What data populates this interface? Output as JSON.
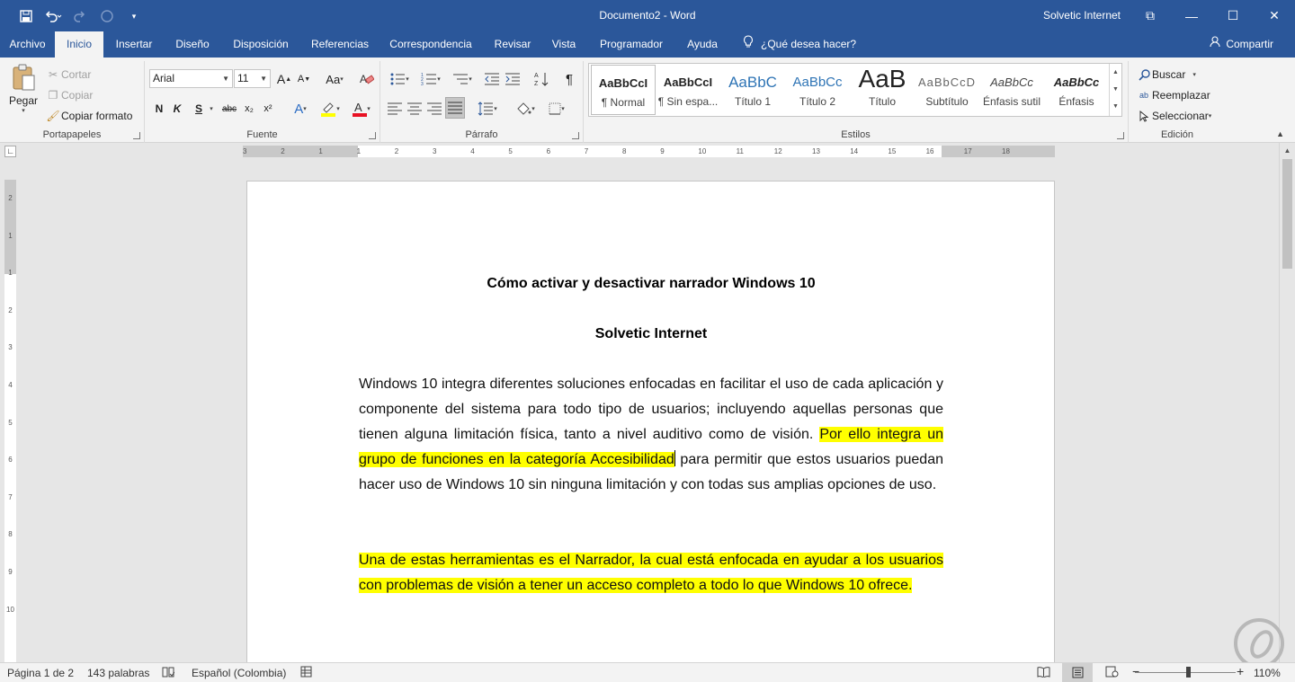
{
  "window": {
    "title": "Documento2 - Word",
    "user": "Solvetic Internet",
    "controls": {
      "restore": "⧉",
      "minimize": "—",
      "maximize": "☐",
      "close": "✕"
    }
  },
  "qat": {
    "save_icon": "save-icon",
    "undo_icon": "undo-icon",
    "redo_icon": "redo-icon",
    "customize_icon": "customize-icon"
  },
  "tabs": [
    {
      "label": "Archivo"
    },
    {
      "label": "Inicio"
    },
    {
      "label": "Insertar"
    },
    {
      "label": "Diseño"
    },
    {
      "label": "Disposición"
    },
    {
      "label": "Referencias"
    },
    {
      "label": "Correspondencia"
    },
    {
      "label": "Revisar"
    },
    {
      "label": "Vista"
    },
    {
      "label": "Programador"
    },
    {
      "label": "Ayuda"
    }
  ],
  "tell_me": "¿Qué desea hacer?",
  "share": "Compartir",
  "clipboard": {
    "label": "Portapapeles",
    "paste": "Pegar",
    "cut": "Cortar",
    "copy": "Copiar",
    "format_painter": "Copiar formato"
  },
  "font": {
    "label": "Fuente",
    "name": "Arial",
    "size": "11",
    "bold": "N",
    "italic": "K",
    "underline": "S",
    "strike": "abc",
    "subscript": "x₂",
    "superscript": "x²",
    "grow": "A",
    "case": "Aa"
  },
  "paragraph": {
    "label": "Párrafo",
    "pilcrow": "¶"
  },
  "styles": {
    "label": "Estilos",
    "items": [
      {
        "sample": "AaBbCcI",
        "name": "¶ Normal"
      },
      {
        "sample": "AaBbCcI",
        "name": "¶ Sin espa..."
      },
      {
        "sample": "AaBbC",
        "name": "Título 1"
      },
      {
        "sample": "AaBbCc",
        "name": "Título 2"
      },
      {
        "sample": "AaB",
        "name": "Título"
      },
      {
        "sample": "AaBbCcD",
        "name": "Subtítulo"
      },
      {
        "sample": "AaBbCc",
        "name": "Énfasis sutil"
      },
      {
        "sample": "AaBbCc",
        "name": "Énfasis"
      }
    ]
  },
  "editing": {
    "label": "Edición",
    "find": "Buscar",
    "replace": "Reemplazar",
    "select": "Seleccionar"
  },
  "ruler": {
    "h_ticks": [
      "3",
      "2",
      "1",
      "1",
      "2",
      "3",
      "4",
      "5",
      "6",
      "7",
      "8",
      "9",
      "10",
      "11",
      "12",
      "13",
      "14",
      "15",
      "16",
      "17",
      "18"
    ],
    "v_ticks": [
      "2",
      "1",
      "1",
      "2",
      "3",
      "4",
      "5",
      "6",
      "7",
      "8",
      "9",
      "10"
    ]
  },
  "document": {
    "title": "Cómo activar y desactivar narrador Windows 10",
    "author": "Solvetic Internet",
    "p1_a": "Windows 10 integra diferentes soluciones enfocadas en facilitar el uso de cada aplicación y componente del sistema para todo tipo de usuarios; incluyendo aquellas personas que tienen alguna limitación física, tanto a nivel auditivo como de visión. ",
    "p1_hl": "Por ello integra un grupo de funciones en la categoría Accesibilidad",
    "p1_b": " para permitir que estos usuarios puedan hacer uso de Windows 10 sin ninguna limitación y con todas sus amplias opciones de uso.",
    "p2_hl": "Una de estas herramientas es el Narrador, la cual está enfocada en ayudar a los usuarios con problemas de visión a tener un acceso completo a todo lo que Windows 10 ofrece."
  },
  "status": {
    "page": "Página 1 de 2",
    "words": "143 palabras",
    "language": "Español (Colombia)",
    "zoom": "110%"
  },
  "colors": {
    "accent": "#2b579a",
    "highlight": "#ffff00",
    "font_color": "#e81123"
  }
}
